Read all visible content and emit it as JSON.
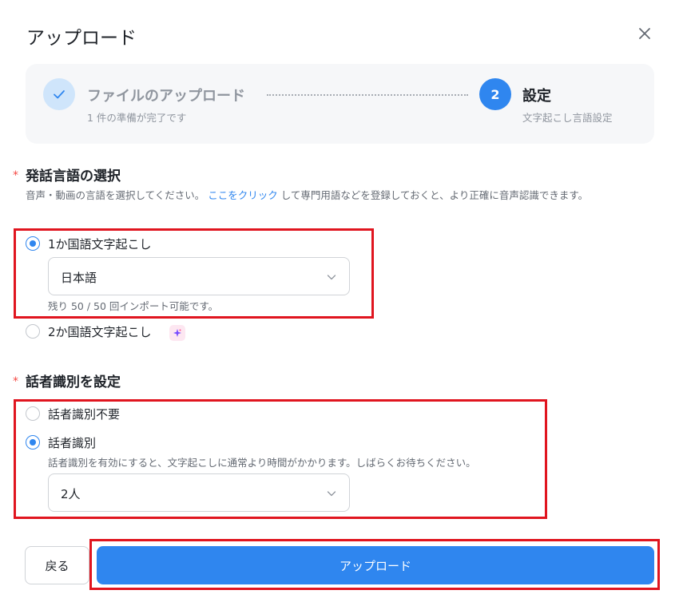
{
  "dialog": {
    "title": "アップロード"
  },
  "steps": {
    "step1": {
      "title": "ファイルのアップロード",
      "subtitle": "1 件の準備が完了です"
    },
    "step2": {
      "number": "2",
      "title": "設定",
      "subtitle": "文字起こし言語設定"
    }
  },
  "language_section": {
    "required_mark": "*",
    "title": "発話言語の選択",
    "desc_before": "音声・動画の言語を選択してください。",
    "desc_link": "ここをクリック",
    "desc_after": "して専門用語などを登録しておくと、より正確に音声認識できます。",
    "option_single": "1か国語文字起こし",
    "selected_language": "日本語",
    "remaining_hint": "残り 50 / 50 回インポート可能です。",
    "option_dual": "2か国語文字起こし"
  },
  "speaker_section": {
    "required_mark": "*",
    "title": "話者識別を設定",
    "option_none": "話者識別不要",
    "option_on": "話者識別",
    "hint": "話者識別を有効にすると、文字起こしに通常より時間がかかります。しばらくお待ちください。",
    "speaker_count": "2人"
  },
  "footer": {
    "back_label": "戻る",
    "upload_label": "アップロード"
  },
  "colors": {
    "accent": "#2f86ef",
    "highlight": "#e0151f",
    "required": "#f54a45"
  }
}
